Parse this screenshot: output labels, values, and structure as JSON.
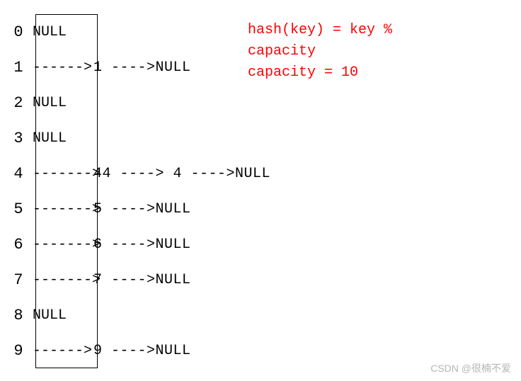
{
  "buckets": [
    {
      "index": "0",
      "cell": "NULL",
      "chain": ""
    },
    {
      "index": "1",
      "cell": " ------>",
      "chain": "1 ---->NULL"
    },
    {
      "index": "2",
      "cell": "NULL",
      "chain": ""
    },
    {
      "index": "3",
      "cell": "NULL",
      "chain": ""
    },
    {
      "index": "4",
      "cell": "------->",
      "chain": "44 ----> 4 ---->NULL"
    },
    {
      "index": "5",
      "cell": "------->",
      "chain": "5 ---->NULL"
    },
    {
      "index": "6",
      "cell": "------->",
      "chain": "6 ---->NULL"
    },
    {
      "index": "7",
      "cell": "------->",
      "chain": "7 ---->NULL"
    },
    {
      "index": "8",
      "cell": "NULL",
      "chain": ""
    },
    {
      "index": "9",
      "cell": " ------>",
      "chain": "9 ---->NULL"
    }
  ],
  "formula": {
    "line1": "hash(key) = key %",
    "line2": "capacity",
    "line3": "capacity = 10"
  },
  "watermark": "CSDN @很楠不爱",
  "chart_data": {
    "type": "diagram",
    "description": "Hash table with separate chaining",
    "capacity": 10,
    "hash_function": "key % capacity",
    "table": [
      {
        "index": 0,
        "chain": []
      },
      {
        "index": 1,
        "chain": [
          1
        ]
      },
      {
        "index": 2,
        "chain": []
      },
      {
        "index": 3,
        "chain": []
      },
      {
        "index": 4,
        "chain": [
          44,
          4
        ]
      },
      {
        "index": 5,
        "chain": [
          5
        ]
      },
      {
        "index": 6,
        "chain": [
          6
        ]
      },
      {
        "index": 7,
        "chain": [
          7
        ]
      },
      {
        "index": 8,
        "chain": []
      },
      {
        "index": 9,
        "chain": [
          9
        ]
      }
    ]
  }
}
